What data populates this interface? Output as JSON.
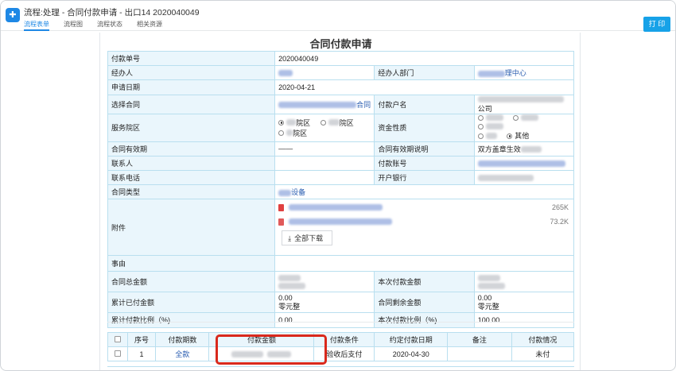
{
  "header": {
    "logo_glyph": "✚",
    "title": "流程:处理 - 合同付款申请 - 出口14 2020040049",
    "tabs": [
      {
        "label": "流程表单",
        "active": true
      },
      {
        "label": "流程图",
        "active": false
      },
      {
        "label": "流程状态",
        "active": false
      },
      {
        "label": "相关资源",
        "active": false
      }
    ],
    "print_label": "打 印"
  },
  "form": {
    "title": "合同付款申请",
    "payment_no_label": "付款单号",
    "payment_no": "2020040049",
    "handler_label": "经办人",
    "handler_dept_label": "经办人部门",
    "handler_dept_suffix": "理中心",
    "apply_date_label": "申请日期",
    "apply_date": "2020-04-21",
    "contract_label": "选择合同",
    "contract_suffix": "合同",
    "payee_label": "付款户名",
    "payee_suffix": "公司",
    "campus_label": "服务院区",
    "campus_options": [
      {
        "label": "院区",
        "checked": true
      },
      {
        "label": "院区",
        "checked": false
      },
      {
        "label": "院区",
        "checked": false
      }
    ],
    "fund_nature_label": "资金性质",
    "fund_options_row1": [
      {
        "label": "",
        "checked": false
      },
      {
        "label": "",
        "checked": false
      },
      {
        "label": "",
        "checked": false
      }
    ],
    "fund_options_row2": [
      {
        "label": "",
        "checked": false
      },
      {
        "label": "其他",
        "checked": true
      }
    ],
    "validity_label": "合同有效期",
    "validity_value": "——",
    "validity_note_label": "合同有效期说明",
    "validity_note": "双方盖章生效",
    "contact_label": "联系人",
    "account_label": "付款账号",
    "phone_label": "联系电话",
    "bank_label": "开户银行",
    "contract_type_label": "合同类型",
    "contract_type_suffix": "设备",
    "attachment_label": "附件",
    "attachments": [
      {
        "size": "265K"
      },
      {
        "size": "73.2K"
      }
    ],
    "download_all_label": "全部下载",
    "download_icon": "⤓",
    "reason_label": "事由",
    "total_amount_label": "合同总金额",
    "current_amount_label": "本次付款金额",
    "paid_amount_label": "累计已付金额",
    "paid_amount": "0.00",
    "paid_amount_cn": "零元整",
    "remaining_label": "合同剩余金额",
    "remaining_amount": "0.00",
    "remaining_cn": "零元整",
    "paid_ratio_label": "累计付款比例（%)",
    "paid_ratio": "0.00",
    "current_ratio_label": "本次付款比例（%)",
    "current_ratio": "100.00"
  },
  "payment_table": {
    "headers": [
      "序号",
      "付款期数",
      "付款金额",
      "付款条件",
      "约定付款日期",
      "备注",
      "付款情况"
    ],
    "rows": [
      {
        "index": "1",
        "period": "全款",
        "condition": "验收后支付",
        "date": "2020-04-30",
        "remark": "",
        "status": "未付"
      }
    ]
  }
}
